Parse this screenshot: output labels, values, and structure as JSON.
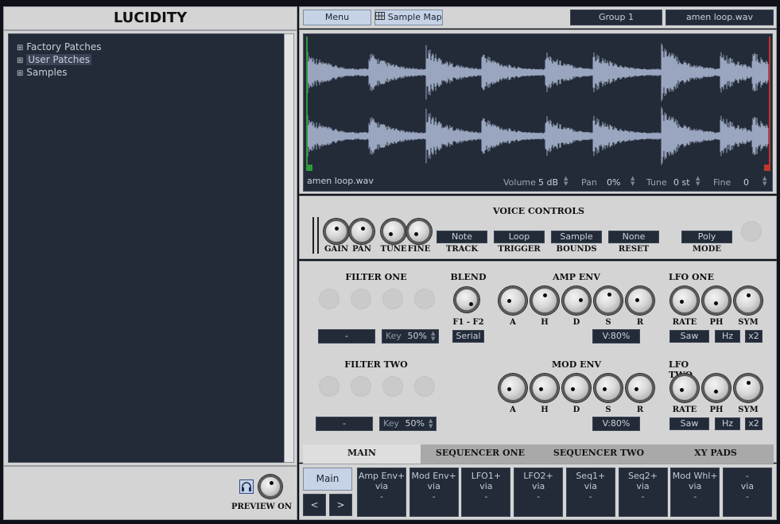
{
  "app": {
    "title": "LUCIDITY"
  },
  "browser": {
    "items": [
      "Factory Patches",
      "User Patches",
      "Samples"
    ]
  },
  "preview": {
    "label": "PREVIEW ON"
  },
  "toolbar": {
    "menu": "Menu",
    "sample_map": "Sample Map",
    "group": "Group 1",
    "file": "amen loop.wav"
  },
  "waveform": {
    "filename": "amen loop.wav",
    "volume_label": "Volume",
    "volume_value": "5 dB",
    "pan_label": "Pan",
    "pan_value": "0%",
    "tune_label": "Tune",
    "tune_value": "0 st",
    "fine_label": "Fine",
    "fine_value": "0"
  },
  "voice": {
    "title": "VOICE CONTROLS",
    "knobs": [
      "GAIN",
      "PAN",
      "TUNE",
      "FINE"
    ],
    "track_value": "Note",
    "track_label": "TRACK",
    "trigger_value": "Loop",
    "trigger_label": "TRIGGER",
    "bounds_value": "Sample",
    "bounds_label": "BOUNDS",
    "reset_value": "None",
    "reset_label": "RESET",
    "mode_value": "Poly",
    "mode_label": "MODE"
  },
  "filter_one": {
    "title": "FILTER ONE",
    "type": "-",
    "key_label": "Key",
    "key_value": "50%"
  },
  "filter_two": {
    "title": "FILTER TWO",
    "type": "-",
    "key_label": "Key",
    "key_value": "50%"
  },
  "blend": {
    "title": "BLEND",
    "knob_label": "F1 - F2",
    "mode": "Serial"
  },
  "amp_env": {
    "title": "AMP ENV",
    "labels": [
      "A",
      "H",
      "D",
      "S",
      "R"
    ],
    "velocity": "V:80%"
  },
  "mod_env": {
    "title": "MOD ENV",
    "labels": [
      "A",
      "H",
      "D",
      "S",
      "R"
    ],
    "velocity": "V:80%"
  },
  "lfo_one": {
    "title": "LFO ONE",
    "labels": [
      "RATE",
      "PH",
      "SYM"
    ],
    "shape": "Saw",
    "unit": "Hz",
    "mult": "x2"
  },
  "lfo_two": {
    "title": "LFO TWO",
    "labels": [
      "RATE",
      "PH",
      "SYM"
    ],
    "shape": "Saw",
    "unit": "Hz",
    "mult": "x2"
  },
  "tabs": [
    "MAIN",
    "SEQUENCER ONE",
    "SEQUENCER TWO",
    "XY PADS"
  ],
  "bottom": {
    "main": "Main",
    "prev": "<",
    "next": ">",
    "slots": [
      {
        "top": "Amp Env+",
        "mid": "via",
        "bot": "-"
      },
      {
        "top": "Mod Env+",
        "mid": "via",
        "bot": "-"
      },
      {
        "top": "LFO1+",
        "mid": "via",
        "bot": "-"
      },
      {
        "top": "LFO2+",
        "mid": "via",
        "bot": "-"
      },
      {
        "top": "Seq1+",
        "mid": "via",
        "bot": "-"
      },
      {
        "top": "Seq2+",
        "mid": "via",
        "bot": "-"
      },
      {
        "top": "Mod Whl+",
        "mid": "via",
        "bot": "-"
      },
      {
        "top": "-",
        "mid": "via",
        "bot": "-"
      }
    ]
  },
  "colors": {
    "accent_dark": "#232b38",
    "panel": "#d4d4d4",
    "waveform": "#9aa6bf",
    "start_marker": "#2e9a3a",
    "end_marker": "#c2362e"
  }
}
